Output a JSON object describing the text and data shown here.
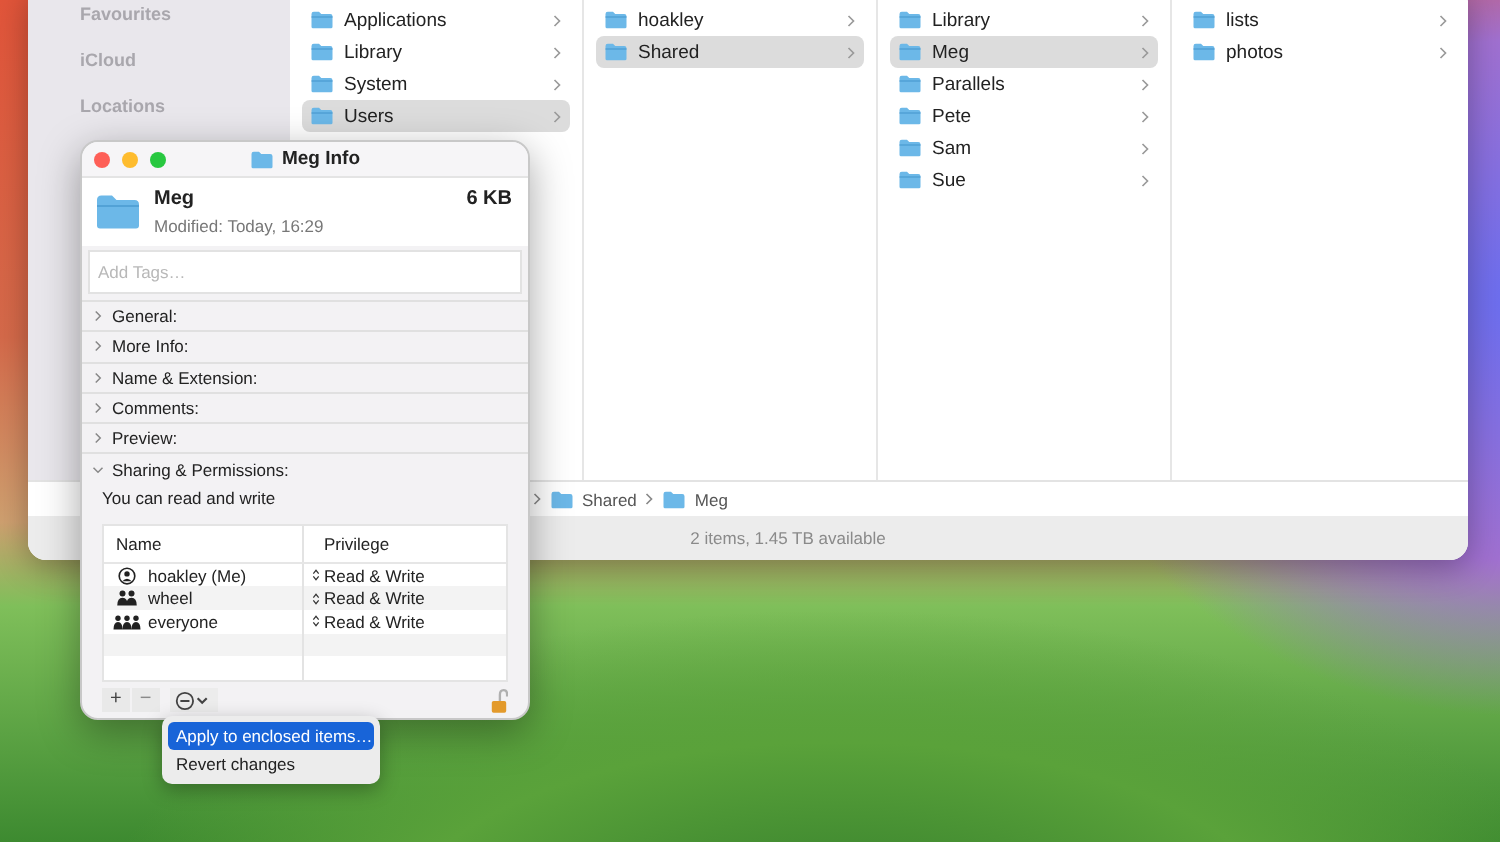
{
  "finder": {
    "sidebar": [
      {
        "label": "Favourites"
      },
      {
        "label": "iCloud"
      },
      {
        "label": "Locations"
      }
    ],
    "columns": [
      [
        {
          "label": "Applications",
          "selected": false
        },
        {
          "label": "Library",
          "selected": false
        },
        {
          "label": "System",
          "selected": false
        },
        {
          "label": "Users",
          "selected": true
        }
      ],
      [
        {
          "label": "hoakley",
          "selected": false
        },
        {
          "label": "Shared",
          "selected": true
        }
      ],
      [
        {
          "label": "Library",
          "selected": false
        },
        {
          "label": "Meg",
          "selected": true
        },
        {
          "label": "Parallels",
          "selected": false
        },
        {
          "label": "Pete",
          "selected": false
        },
        {
          "label": "Sam",
          "selected": false
        },
        {
          "label": "Sue",
          "selected": false
        }
      ],
      [
        {
          "label": "lists",
          "selected": false
        },
        {
          "label": "photos",
          "selected": false
        }
      ]
    ],
    "path_bar": [
      "Shared",
      "Meg"
    ],
    "status_bar": "2 items, 1.45 TB available"
  },
  "info_window": {
    "title": "Meg Info",
    "name": "Meg",
    "size": "6 KB",
    "modified": "Modified: Today, 16:29",
    "tags": {
      "placeholder": "Add Tags…"
    },
    "sections": [
      {
        "label": "General:",
        "expanded": false
      },
      {
        "label": "More Info:",
        "expanded": false
      },
      {
        "label": "Name & Extension:",
        "expanded": false
      },
      {
        "label": "Comments:",
        "expanded": false
      },
      {
        "label": "Preview:",
        "expanded": false
      },
      {
        "label": "Sharing & Permissions:",
        "expanded": true
      }
    ],
    "access_note": "You can read and write",
    "table": {
      "columns": [
        "Name",
        "Privilege"
      ],
      "rows": [
        {
          "kind": "user",
          "name": "hoakley (Me)",
          "privilege": "Read & Write"
        },
        {
          "kind": "group",
          "name": "wheel",
          "privilege": "Read & Write"
        },
        {
          "kind": "everyone",
          "name": "everyone",
          "privilege": "Read & Write"
        }
      ]
    },
    "toolbar": {
      "add": "+",
      "remove": "−"
    },
    "locked": false
  },
  "menu": [
    {
      "label": "Apply to enclosed items…",
      "selected": true
    },
    {
      "label": "Revert changes",
      "selected": false
    }
  ]
}
